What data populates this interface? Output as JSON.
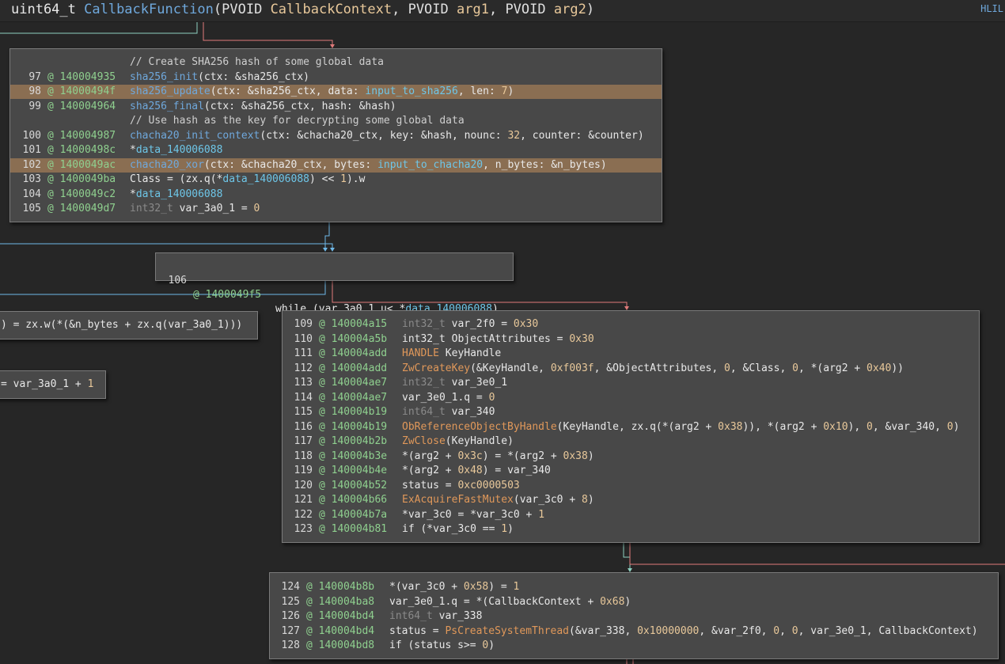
{
  "header": {
    "signature": {
      "ret": "uint64_t ",
      "name": "CallbackFunction",
      "open": "(",
      "t1": "PVOID ",
      "p1": "CallbackContext",
      "sep1": ", ",
      "t2": "PVOID ",
      "p2": "arg1",
      "sep2": ", ",
      "t3": "PVOID ",
      "p3": "arg2",
      "close": ")"
    },
    "view_label": "HLIL"
  },
  "block1": {
    "comment1": "// Create SHA256 hash of some global data",
    "lines": [
      {
        "ln": "97",
        "addr": "140004935",
        "parts": [
          [
            "fn",
            "sha256_init"
          ],
          [
            "plain",
            "(ctx: &sha256_ctx)"
          ]
        ]
      },
      {
        "ln": "98",
        "addr": "14000494f",
        "hl": true,
        "parts": [
          [
            "fn",
            "sha256_update"
          ],
          [
            "plain",
            "(ctx: &sha256_ctx, data: "
          ],
          [
            "data",
            "input_to_sha256"
          ],
          [
            "plain",
            ", len: "
          ],
          [
            "num",
            "7"
          ],
          [
            "plain",
            ")"
          ]
        ]
      },
      {
        "ln": "99",
        "addr": "140004964",
        "parts": [
          [
            "fn",
            "sha256_final"
          ],
          [
            "plain",
            "(ctx: &sha256_ctx, hash: &hash)"
          ]
        ]
      }
    ],
    "comment2": "// Use hash as the key for decrypting some global data",
    "lines2": [
      {
        "ln": "100",
        "addr": "140004987",
        "parts": [
          [
            "fn",
            "chacha20_init_context"
          ],
          [
            "plain",
            "(ctx: &chacha20_ctx, key: &hash, nounc: "
          ],
          [
            "num",
            "32"
          ],
          [
            "plain",
            ", counter: &counter)"
          ]
        ]
      },
      {
        "ln": "101",
        "addr": "14000498c",
        "parts": [
          [
            "plain",
            "*"
          ],
          [
            "data",
            "data_140006088"
          ]
        ]
      },
      {
        "ln": "102",
        "addr": "1400049ac",
        "hl": true,
        "parts": [
          [
            "fn",
            "chacha20_xor"
          ],
          [
            "plain",
            "(ctx: &chacha20_ctx, bytes: "
          ],
          [
            "data",
            "input_to_chacha20"
          ],
          [
            "plain",
            ", n_bytes: &n_bytes)"
          ]
        ]
      },
      {
        "ln": "103",
        "addr": "1400049ba",
        "parts": [
          [
            "plain",
            "Class = (zx.q(*"
          ],
          [
            "data",
            "data_140006088"
          ],
          [
            "plain",
            ") << "
          ],
          [
            "num",
            "1"
          ],
          [
            "plain",
            ").w"
          ]
        ]
      },
      {
        "ln": "104",
        "addr": "1400049c2",
        "parts": [
          [
            "plain",
            "*"
          ],
          [
            "data",
            "data_140006088"
          ]
        ]
      },
      {
        "ln": "105",
        "addr": "1400049d7",
        "parts": [
          [
            "type",
            "int32_t "
          ],
          [
            "plain",
            "var_3a0_1 = "
          ],
          [
            "num",
            "0"
          ]
        ]
      }
    ]
  },
  "block2": {
    "ln": "106",
    "addr": "1400049f5",
    "parts": [
      [
        "plain",
        "while (var_3a0_1 u< *"
      ],
      [
        "data",
        "data_140006088"
      ],
      [
        "plain",
        ")"
      ]
    ]
  },
  "block3": {
    "parts": [
      [
        "plain",
        ") = zx.w(*(&n_bytes + zx.q(var_3a0_1)))"
      ]
    ]
  },
  "block4": {
    "parts": [
      [
        "plain",
        "= var_3a0_1 + "
      ],
      [
        "num",
        "1"
      ]
    ]
  },
  "block5": {
    "lines": [
      {
        "ln": "109",
        "addr": "140004a15",
        "parts": [
          [
            "type",
            "int32_t "
          ],
          [
            "plain",
            "var_2f0 = "
          ],
          [
            "num",
            "0x30"
          ]
        ]
      },
      {
        "ln": "110",
        "addr": "140004a5b",
        "parts": [
          [
            "type2",
            "int32_t "
          ],
          [
            "plain",
            "ObjectAttributes = "
          ],
          [
            "num",
            "0x30"
          ]
        ]
      },
      {
        "ln": "111",
        "addr": "140004add",
        "parts": [
          [
            "fn2",
            "HANDLE "
          ],
          [
            "plain",
            "KeyHandle"
          ]
        ]
      },
      {
        "ln": "112",
        "addr": "140004add",
        "parts": [
          [
            "fn2",
            "ZwCreateKey"
          ],
          [
            "plain",
            "(&KeyHandle, "
          ],
          [
            "num",
            "0xf003f"
          ],
          [
            "plain",
            ", &ObjectAttributes, "
          ],
          [
            "num",
            "0"
          ],
          [
            "plain",
            ", &Class, "
          ],
          [
            "num",
            "0"
          ],
          [
            "plain",
            ", *(arg2 + "
          ],
          [
            "num",
            "0x40"
          ],
          [
            "plain",
            "))"
          ]
        ]
      },
      {
        "ln": "113",
        "addr": "140004ae7",
        "parts": [
          [
            "type",
            "int32_t "
          ],
          [
            "plain",
            "var_3e0_1"
          ]
        ]
      },
      {
        "ln": "114",
        "addr": "140004ae7",
        "parts": [
          [
            "plain",
            "var_3e0_1.q = "
          ],
          [
            "num",
            "0"
          ]
        ]
      },
      {
        "ln": "115",
        "addr": "140004b19",
        "parts": [
          [
            "type",
            "int64_t "
          ],
          [
            "plain",
            "var_340"
          ]
        ]
      },
      {
        "ln": "116",
        "addr": "140004b19",
        "parts": [
          [
            "fn2",
            "ObReferenceObjectByHandle"
          ],
          [
            "plain",
            "(KeyHandle, zx.q(*(arg2 + "
          ],
          [
            "num",
            "0x38"
          ],
          [
            "plain",
            ")), *(arg2 + "
          ],
          [
            "num",
            "0x10"
          ],
          [
            "plain",
            "), "
          ],
          [
            "num",
            "0"
          ],
          [
            "plain",
            ", &var_340, "
          ],
          [
            "num",
            "0"
          ],
          [
            "plain",
            ")"
          ]
        ]
      },
      {
        "ln": "117",
        "addr": "140004b2b",
        "parts": [
          [
            "fn2",
            "ZwClose"
          ],
          [
            "plain",
            "(KeyHandle)"
          ]
        ]
      },
      {
        "ln": "118",
        "addr": "140004b3e",
        "parts": [
          [
            "plain",
            "*(arg2 + "
          ],
          [
            "num",
            "0x3c"
          ],
          [
            "plain",
            ") = *(arg2 + "
          ],
          [
            "num",
            "0x38"
          ],
          [
            "plain",
            ")"
          ]
        ]
      },
      {
        "ln": "119",
        "addr": "140004b4e",
        "parts": [
          [
            "plain",
            "*(arg2 + "
          ],
          [
            "num",
            "0x48"
          ],
          [
            "plain",
            ") = var_340"
          ]
        ]
      },
      {
        "ln": "120",
        "addr": "140004b52",
        "parts": [
          [
            "plain",
            "status = "
          ],
          [
            "num",
            "0xc0000503"
          ]
        ]
      },
      {
        "ln": "121",
        "addr": "140004b66",
        "parts": [
          [
            "fn2",
            "ExAcquireFastMutex"
          ],
          [
            "plain",
            "(var_3c0 + "
          ],
          [
            "num",
            "8"
          ],
          [
            "plain",
            ")"
          ]
        ]
      },
      {
        "ln": "122",
        "addr": "140004b7a",
        "parts": [
          [
            "plain",
            "*var_3c0 = *var_3c0 + "
          ],
          [
            "num",
            "1"
          ]
        ]
      },
      {
        "ln": "123",
        "addr": "140004b81",
        "parts": [
          [
            "plain",
            "if (*var_3c0 == "
          ],
          [
            "num",
            "1"
          ],
          [
            "plain",
            ")"
          ]
        ]
      }
    ]
  },
  "block6": {
    "lines": [
      {
        "ln": "124",
        "addr": "140004b8b",
        "parts": [
          [
            "plain",
            "*(var_3c0 + "
          ],
          [
            "num",
            "0x58"
          ],
          [
            "plain",
            ") = "
          ],
          [
            "num",
            "1"
          ]
        ]
      },
      {
        "ln": "125",
        "addr": "140004ba8",
        "parts": [
          [
            "plain",
            "var_3e0_1.q = *(CallbackContext + "
          ],
          [
            "num",
            "0x68"
          ],
          [
            "plain",
            ")"
          ]
        ]
      },
      {
        "ln": "126",
        "addr": "140004bd4",
        "parts": [
          [
            "type",
            "int64_t "
          ],
          [
            "plain",
            "var_338"
          ]
        ]
      },
      {
        "ln": "127",
        "addr": "140004bd4",
        "parts": [
          [
            "plain",
            "status = "
          ],
          [
            "fn2",
            "PsCreateSystemThread"
          ],
          [
            "plain",
            "(&var_338, "
          ],
          [
            "num",
            "0x10000000"
          ],
          [
            "plain",
            ", &var_2f0, "
          ],
          [
            "num",
            "0"
          ],
          [
            "plain",
            ", "
          ],
          [
            "num",
            "0"
          ],
          [
            "plain",
            ", var_3e0_1, CallbackContext)"
          ]
        ]
      },
      {
        "ln": "128",
        "addr": "140004bd8",
        "parts": [
          [
            "plain",
            "if (status s>= "
          ],
          [
            "num",
            "0"
          ],
          [
            "plain",
            ")"
          ]
        ]
      }
    ]
  },
  "colors": {
    "background": "#262626",
    "block": "#484848",
    "highlight": "#8a6e52",
    "function": "#6fa8dc",
    "import": "#e0985a",
    "address": "#8fd08f",
    "number": "#e8c89a",
    "edge_true": "#e07a7a",
    "edge_false": "#6fb8e8",
    "edge_uncond": "#8fd0c0"
  }
}
